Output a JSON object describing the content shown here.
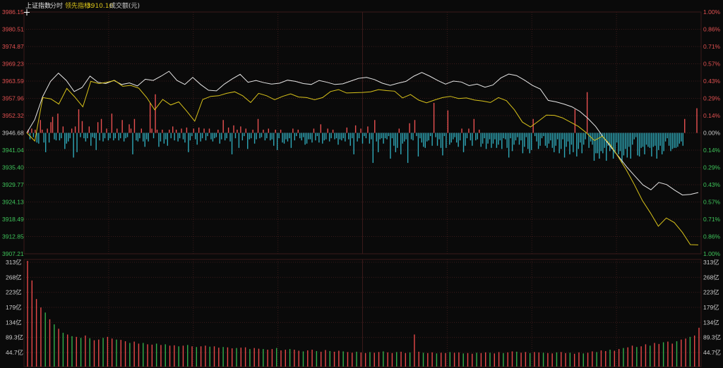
{
  "header": {
    "index_name": "上证指数",
    "mode": "分时",
    "leading_label": "领先指标:",
    "leading_value": "3910.10",
    "volume_label": "成交额(元)"
  },
  "colors": {
    "background": "#0a0a0a",
    "grid": "#3a1a1a",
    "up": "#e85050",
    "down": "#2fa8b8",
    "price_line": "#e6e6e6",
    "leading_line": "#d8c21a",
    "label_up": "#e05050",
    "label_down": "#3fc45a",
    "label_flat": "#c8c8c8",
    "vol_up": "#e84848",
    "vol_down": "#32b04a"
  },
  "chart_data": [
    {
      "type": "line",
      "title": "",
      "x_start": "09:30",
      "x_end": "15:00",
      "ylim": [
        3907.21,
        3986.15
      ],
      "base": 3946.68,
      "y_ticks_left": [
        "3986.15",
        "3980.51",
        "3974.87",
        "3969.23",
        "3963.59",
        "3957.96",
        "3952.32",
        "3946.68",
        "3941.04",
        "3935.40",
        "3929.77",
        "3924.13",
        "3918.49",
        "3912.85",
        "3907.21"
      ],
      "y_ticks_right": [
        "1.00%",
        "0.86%",
        "0.71%",
        "0.57%",
        "0.43%",
        "0.29%",
        "0.14%",
        "0.00%",
        "0.14%",
        "0.29%",
        "0.43%",
        "0.57%",
        "0.71%",
        "0.86%",
        "1.00%"
      ],
      "series": [
        {
          "role": "price",
          "values": [
            3946.7,
            3951,
            3958.5,
            3963.5,
            3966.2,
            3963.8,
            3960.2,
            3961.5,
            3965.2,
            3963.2,
            3962.8,
            3963.8,
            3962.5,
            3963,
            3962,
            3964.2,
            3963.8,
            3965.2,
            3966.8,
            3963.8,
            3962.5,
            3964.8,
            3962.5,
            3960.6,
            3960.4,
            3962.6,
            3964.3,
            3965.8,
            3963.2,
            3963.8,
            3963.1,
            3962.6,
            3962.9,
            3963.9,
            3963.5,
            3962.8,
            3962.5,
            3963.8,
            3963.2,
            3962.5,
            3962.7,
            3963.6,
            3964.5,
            3964.8,
            3964.1,
            3962.9,
            3962.2,
            3962.9,
            3963.5,
            3965.2,
            3966.4,
            3965.2,
            3963.8,
            3962.6,
            3963.6,
            3963.3,
            3962.1,
            3962.6,
            3961.6,
            3962.3,
            3964.6,
            3965.9,
            3965.4,
            3963.9,
            3962.2,
            3961,
            3957.3,
            3956.8,
            3956.1,
            3955.2,
            3953.7,
            3951.5,
            3948.8,
            3945.2,
            3941.9,
            3938.7,
            3935.4,
            3932.5,
            3929.7,
            3928.1,
            3930.5,
            3929.8,
            3928,
            3926.4,
            3926.6,
            3927.2
          ],
          "name": ""
        },
        {
          "role": "leading",
          "values": [
            3946.7,
            3944,
            3958.2,
            3957.8,
            3956.1,
            3961.2,
            3958.4,
            3955.2,
            3963.5,
            3962.8,
            3963.2,
            3963.8,
            3961.9,
            3962.2,
            3961.3,
            3958.2,
            3954.2,
            3957.6,
            3955.8,
            3956.8,
            3953.8,
            3950.5,
            3957.6,
            3958.6,
            3958.8,
            3959.6,
            3960.1,
            3958.8,
            3956.6,
            3959.6,
            3958.8,
            3957.5,
            3958.6,
            3959.4,
            3958.4,
            3958.2,
            3957.5,
            3958.2,
            3960.2,
            3960.8,
            3959.7,
            3959.8,
            3959.9,
            3960.1,
            3960.8,
            3960.5,
            3960.3,
            3958.1,
            3959.2,
            3957.4,
            3956.5,
            3957.4,
            3958.2,
            3958.6,
            3957.9,
            3958.1,
            3957.4,
            3957.1,
            3956.6,
            3958.2,
            3957.2,
            3954.2,
            3950.2,
            3948.6,
            3950.5,
            3952.5,
            3952.4,
            3951.6,
            3950.2,
            3948.8,
            3946.7,
            3944.2,
            3945.6,
            3942.8,
            3938.8,
            3934.6,
            3929.8,
            3924.6,
            3920.6,
            3916.2,
            3918.9,
            3917.4,
            3914.2,
            3910.2,
            3910.1
          ],
          "name": ""
        }
      ],
      "bars": [
        3,
        -6,
        4,
        -4,
        3,
        -9,
        -10,
        12,
        3,
        -9,
        -18,
        4,
        -9,
        10,
        15,
        -6,
        -7,
        18,
        -7,
        -5,
        6,
        -15,
        -10,
        -8,
        -5,
        4,
        -23,
        6,
        -18,
        22,
        -4,
        11,
        -5,
        -8,
        -5,
        6,
        -12,
        -4,
        -5,
        -16,
        10,
        -7,
        13,
        -8,
        -5,
        4,
        -7,
        -5,
        18,
        -7,
        -5,
        4,
        -7,
        -5,
        12,
        -8,
        -5,
        -4,
        8,
        4,
        -20,
        13,
        -7,
        -8,
        -5,
        4,
        -8,
        -13,
        -6,
        -8,
        -11,
        4,
        -5,
        8,
        3,
        -13,
        -8,
        3,
        -10,
        -6,
        -12,
        3,
        -5,
        6,
        -7,
        3,
        -8,
        -5,
        4,
        -6,
        -9,
        5,
        -18,
        -7,
        -3,
        4,
        -6,
        -11,
        5,
        -8,
        -5,
        4,
        -7,
        -3,
        4,
        -6,
        -8,
        -5,
        -4,
        3,
        -10,
        -6,
        12,
        -7,
        -5,
        5,
        -8,
        -20,
        7,
        -5,
        3,
        -14,
        6,
        -7,
        -3,
        4,
        -15,
        -6,
        -5,
        3,
        -10,
        -6,
        13,
        -5,
        -4,
        3,
        -7,
        -5,
        4,
        -7,
        -6,
        -12,
        3,
        -16,
        -5,
        3,
        -9,
        -10,
        -6,
        -8,
        -5,
        -14,
        4,
        -7,
        -3,
        3,
        -5,
        -7,
        -4,
        -11,
        -10,
        -6,
        -6,
        -9,
        4,
        -7,
        -3,
        -9,
        8,
        -10,
        -7,
        -6,
        4,
        -8,
        -5,
        3,
        -6,
        -5,
        -11,
        -6,
        -7,
        -5,
        -8,
        5,
        -6,
        -12,
        -5,
        -20,
        7,
        -8,
        -5,
        4,
        -10,
        -3,
        -5,
        6,
        -10,
        -6,
        -28,
        12,
        -8,
        -18,
        -6,
        -5,
        -10,
        -5,
        -6,
        -3,
        -24,
        -5,
        -12,
        -18,
        -14,
        4,
        -20,
        -10,
        -8,
        -6,
        -28,
        9,
        -6,
        -7,
        12,
        -3,
        -22,
        -5,
        -9,
        -13,
        -14,
        -8,
        -7,
        -3,
        -12,
        -5,
        -4,
        -12,
        -6,
        -14,
        -21,
        -3,
        -14,
        -18,
        -11,
        -9,
        -6,
        -4,
        -9,
        -13,
        -7,
        4,
        -18,
        -12,
        -5,
        4,
        -7,
        -12,
        13,
        -7,
        -6,
        3,
        -13,
        -10,
        -5,
        -15,
        -10,
        -6,
        -14,
        -10,
        -6,
        -14,
        -11,
        -7,
        -15,
        -5,
        -6,
        -14,
        -23,
        -5,
        -17,
        -11,
        -7,
        -4,
        -11,
        -7,
        -19,
        -13,
        -4,
        -15,
        -19,
        -16,
        -9,
        -3,
        -8,
        -15,
        -12,
        -5,
        -3,
        -12,
        -14,
        -10,
        -7,
        -14,
        -18,
        -12,
        -6,
        -19,
        -15,
        -6,
        -23,
        -13,
        -8,
        -20,
        -11,
        -18,
        -7,
        -22,
        -15,
        -9,
        -19,
        -11,
        -6,
        -13,
        -14,
        -8,
        -11,
        -26,
        -19,
        -19,
        -24,
        -17,
        -19,
        -14,
        -26,
        -12,
        -17,
        -15,
        -24,
        -19,
        -9,
        -20,
        -17,
        -28,
        -21,
        -15,
        -23,
        -13,
        -24,
        -11,
        -6,
        -4,
        -21,
        -22,
        -14,
        -13,
        -20,
        -11,
        -13,
        -14,
        -22,
        -13,
        -12,
        -24,
        -16,
        -12,
        -20,
        -17,
        -8,
        -5,
        -12,
        -17,
        -15,
        -14,
        -14,
        -13,
        -10,
        -8,
        -12,
        -3
      ],
      "bar_overrides": {
        "70": 28,
        "73": 36,
        "233": 28,
        "241": 21,
        "290": 13,
        "314": 22,
        "321": 38,
        "377": 13,
        "384": 23
      }
    },
    {
      "type": "bar",
      "ylim": [
        0,
        313
      ],
      "y_ticks_left": [
        "313亿",
        "268亿",
        "223亿",
        "179亿",
        "134亿",
        "89.3亿",
        "44.7亿"
      ],
      "y_ticks_right": [
        "313亿",
        "268亿",
        "223亿",
        "179亿",
        "134亿",
        "89.3亿",
        "44.7亿"
      ],
      "values": [
        313,
        255,
        200,
        175,
        160,
        140,
        125,
        112,
        100,
        95,
        90,
        88,
        85,
        92,
        84,
        78,
        80,
        85,
        88,
        83,
        80,
        79,
        75,
        70,
        74,
        68,
        70,
        66,
        65,
        68,
        64,
        66,
        62,
        63,
        60,
        62,
        64,
        60,
        58,
        60,
        62,
        59,
        60,
        56,
        58,
        57,
        54,
        55,
        56,
        57,
        52,
        55,
        53,
        52,
        50,
        52,
        55,
        48,
        50,
        52,
        50,
        47,
        45,
        48,
        50,
        46,
        44,
        49,
        46,
        44,
        47,
        45,
        43,
        41,
        44,
        42,
        40,
        43,
        41,
        43,
        45,
        42,
        40,
        43,
        44,
        40,
        42,
        95,
        44,
        41,
        40,
        42,
        39,
        41,
        40,
        43,
        41,
        42,
        39,
        40,
        38,
        41,
        40,
        42,
        41,
        39,
        43,
        40,
        42,
        45,
        44,
        41,
        43,
        40,
        43,
        42,
        41,
        40,
        39,
        42,
        43,
        40,
        41,
        38,
        42,
        39,
        41,
        45,
        43,
        48,
        46,
        50,
        47,
        52,
        55,
        57,
        62,
        58,
        60,
        66,
        62,
        70,
        67,
        72,
        74,
        68,
        75,
        80,
        83,
        88,
        92,
        115
      ],
      "vol_up": [
        0,
        1,
        2,
        3,
        5,
        7,
        9,
        11,
        13,
        15,
        16,
        18,
        19,
        21,
        22,
        24,
        25,
        27,
        28,
        30,
        32,
        33,
        35,
        37,
        39,
        40,
        42,
        43,
        45,
        46,
        48,
        49,
        51,
        52,
        54,
        55,
        57,
        58,
        60,
        61,
        63,
        64,
        66,
        67,
        69,
        70,
        72,
        73,
        75,
        76,
        78,
        79,
        81,
        82,
        84,
        85,
        87,
        88,
        90,
        91,
        93,
        94,
        96,
        97,
        99,
        100,
        102,
        103,
        105,
        106,
        108,
        109,
        111,
        112,
        114,
        115,
        117,
        118,
        120,
        121,
        123,
        124,
        126,
        127,
        129,
        130,
        132,
        133,
        135,
        136,
        138,
        139,
        141,
        142,
        144,
        145,
        147,
        148,
        150,
        151,
        153,
        154,
        156
      ]
    }
  ]
}
